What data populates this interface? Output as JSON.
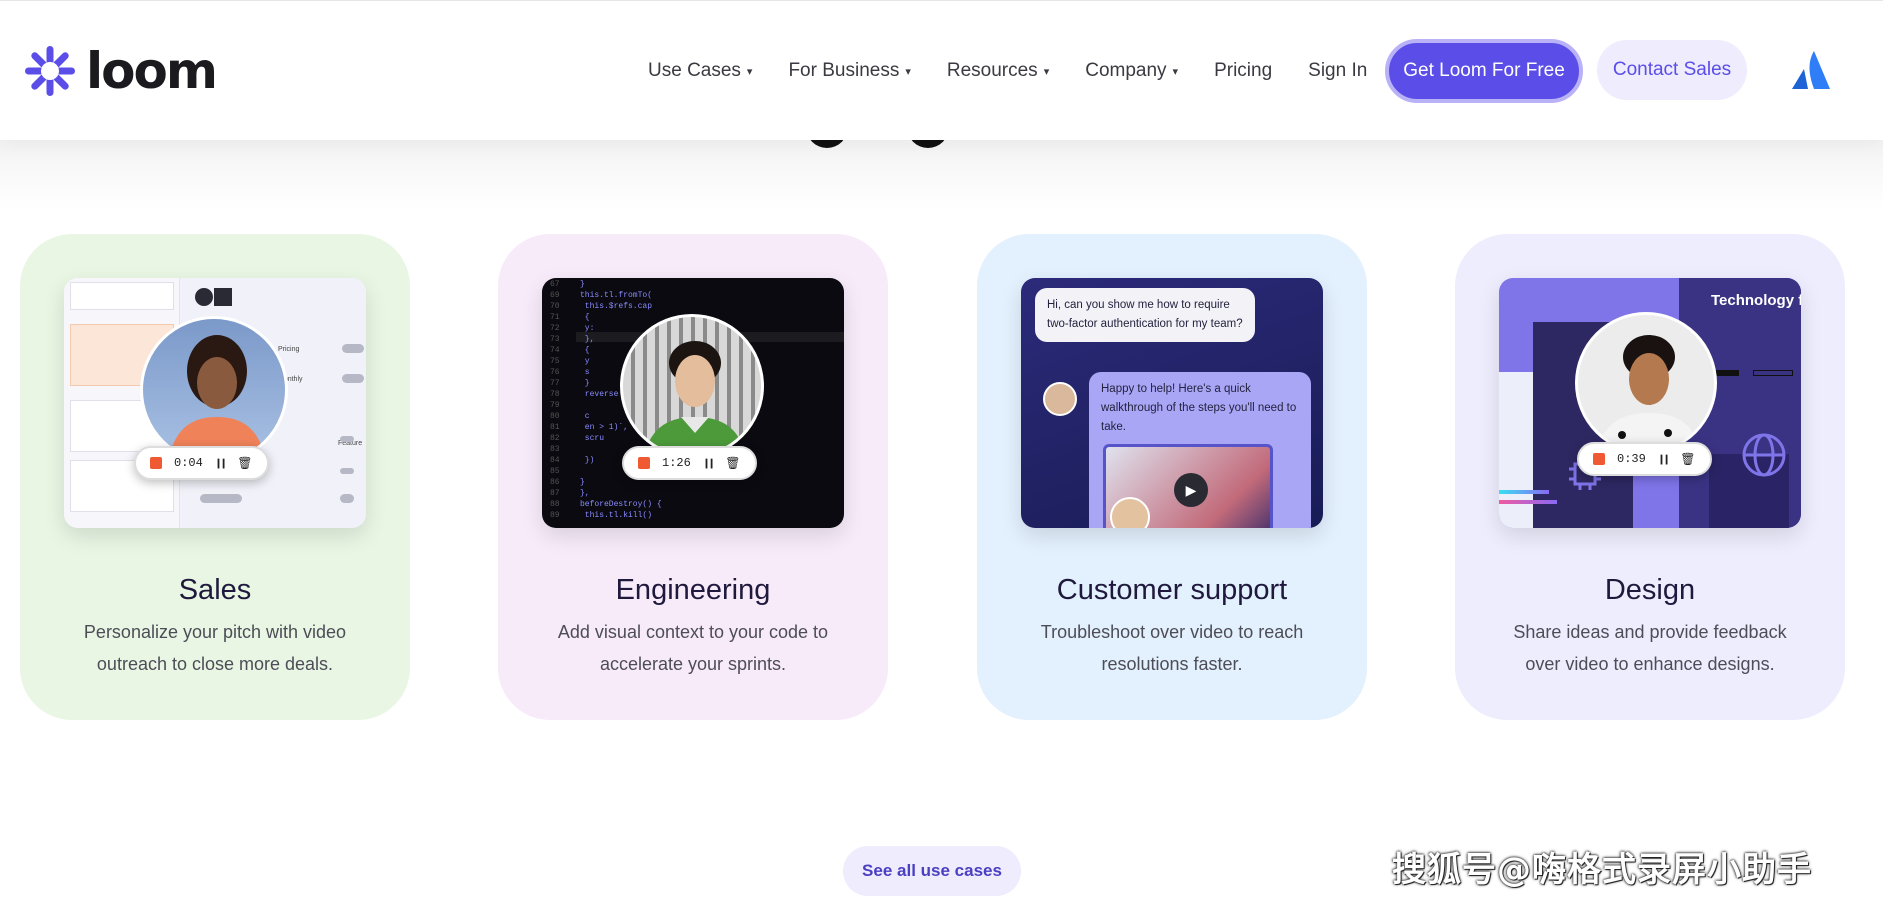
{
  "header": {
    "logo_text": "loom",
    "nav": [
      {
        "label": "Use Cases",
        "has_caret": true
      },
      {
        "label": "For Business",
        "has_caret": true
      },
      {
        "label": "Resources",
        "has_caret": true
      },
      {
        "label": "Company",
        "has_caret": true
      },
      {
        "label": "Pricing",
        "has_caret": false
      },
      {
        "label": "Sign In",
        "has_caret": false
      }
    ],
    "caret_glyph": "▾",
    "cta_primary": "Get Loom For Free",
    "cta_secondary": "Contact Sales",
    "brand_icon": "atlassian-icon"
  },
  "cards": {
    "sales": {
      "title": "Sales",
      "description": "Personalize your pitch with video outreach to close more deals.",
      "timer": "0:04",
      "thumb_labels": [
        "Pricing",
        "Monthly",
        "Feature"
      ]
    },
    "engineering": {
      "title": "Engineering",
      "description": "Add visual context to your code to accelerate your sprints.",
      "timer": "1:26",
      "code": [
        {
          "n": "67",
          "t": "}"
        },
        {
          "n": "69",
          "t": "this.tl.fromTo("
        },
        {
          "n": "70",
          "t": "  this.$refs.cap"
        },
        {
          "n": "71",
          "t": "  {"
        },
        {
          "n": "72",
          "t": "    y:"
        },
        {
          "n": "73",
          "t": "  },"
        },
        {
          "n": "74",
          "t": "  {"
        },
        {
          "n": "75",
          "t": "    y"
        },
        {
          "n": "76",
          "t": "    s"
        },
        {
          "n": "77",
          "t": "  }"
        },
        {
          "n": "78",
          "t": "                              reverse pause',"
        },
        {
          "n": "79",
          "t": ""
        },
        {
          "n": "80",
          "t": "  c"
        },
        {
          "n": "81",
          "t": "  en                    > 1)`,"
        },
        {
          "n": "82",
          "t": "  scru"
        },
        {
          "n": "83",
          "t": ""
        },
        {
          "n": "84",
          "t": "  })"
        },
        {
          "n": "85",
          "t": ""
        },
        {
          "n": "86",
          "t": "}"
        },
        {
          "n": "87",
          "t": "},"
        },
        {
          "n": "88",
          "t": "beforeDestroy() {"
        },
        {
          "n": "89",
          "t": "  this.tl.kill()"
        }
      ]
    },
    "customer_support": {
      "title": "Customer support",
      "description": "Troubleshoot over video to reach resolutions faster.",
      "question": "Hi, can you show me how to require two-factor authentication for my team?",
      "answer": "Happy to help! Here's a quick walkthrough of the steps you'll need to take."
    },
    "design": {
      "title": "Design",
      "description": "Share ideas and provide feedback over video to enhance designs.",
      "timer": "0:39",
      "banner": "Technology for Tomorrow"
    }
  },
  "see_all": "See all use cases",
  "watermark": "搜狐号@嗨格式录屏小助手",
  "colors": {
    "brand": "#5a4de8",
    "sales_bg": "#e9f6e4",
    "eng_bg": "#f7ebf9",
    "cs_bg": "#e3f0fd",
    "design_bg": "#eeedfd"
  }
}
